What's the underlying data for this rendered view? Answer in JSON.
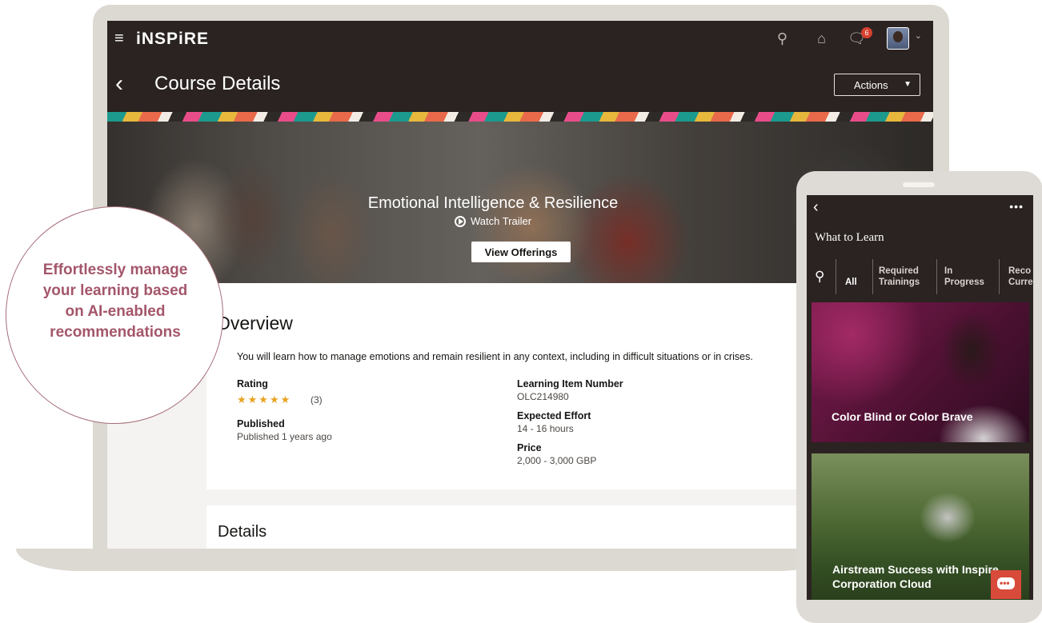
{
  "app": {
    "brand": "iNSPiRE",
    "page_title": "Course Details",
    "actions_label": "Actions",
    "notification_count": "6"
  },
  "hero": {
    "course_title": "Emotional Intelligence & Resilience",
    "watch_trailer": "Watch Trailer",
    "view_offerings": "View Offerings"
  },
  "overview": {
    "title": "Overview",
    "description": "You will learn how to manage emotions and remain resilient in any context, including in difficult situations or in crises.",
    "rating_label": "Rating",
    "rating_stars": "★★★★★",
    "rating_value": 5,
    "rating_count": "(3)",
    "published_label": "Published",
    "published_value": "Published 1 years ago",
    "item_number_label": "Learning Item Number",
    "item_number_value": "OLC214980",
    "effort_label": "Expected Effort",
    "effort_value": "14 - 16 hours",
    "price_label": "Price",
    "price_value": "2,000 - 3,000 GBP"
  },
  "details": {
    "title": "Details"
  },
  "callout": {
    "text": "Effortlessly manage your learning based on AI-enabled recommendations"
  },
  "mobile": {
    "title": "What to Learn",
    "tabs": [
      {
        "label": "All"
      },
      {
        "label": "Required Trainings"
      },
      {
        "label": "In Progress"
      },
      {
        "label": "Reco Curre"
      }
    ],
    "cards": [
      {
        "title": "Color Blind or Color Brave"
      },
      {
        "title": "Airstream Success with Inspire Corporation Cloud"
      }
    ]
  },
  "icons": {
    "menu": "hamburger-icon",
    "search": "search-icon",
    "home": "home-icon",
    "notifications": "bell-icon",
    "back": "chevron-left-icon",
    "more": "more-icon",
    "chat": "chat-icon"
  },
  "colors": {
    "header_bg": "#2a2321",
    "callout_text": "#a4566a",
    "star": "#e8a320",
    "badge": "#d6402f",
    "chat_button": "#d84a3a"
  }
}
